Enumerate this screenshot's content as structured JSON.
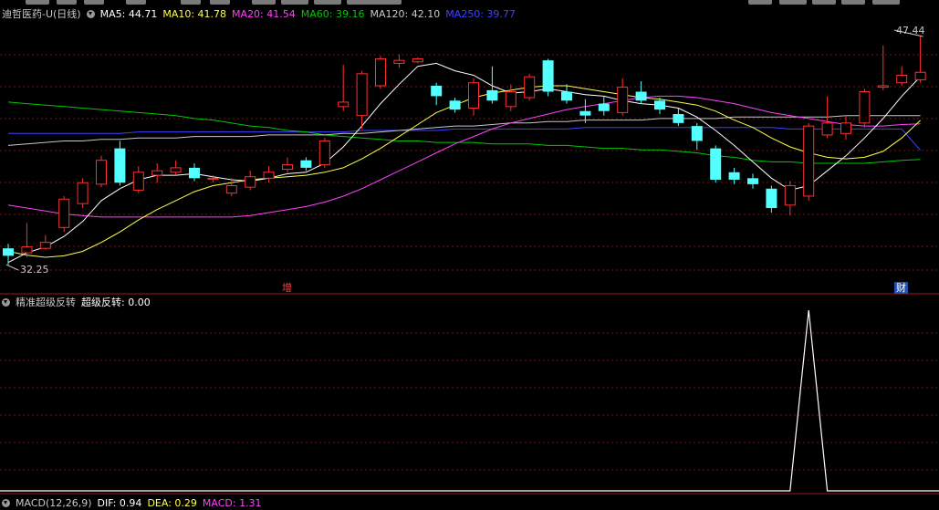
{
  "header": {
    "stock_name": "迪哲医药-U(日线)",
    "ma5": "MA5: 44.71",
    "ma10": "MA10: 41.78",
    "ma20": "MA20: 41.54",
    "ma60": "MA60: 39.16",
    "ma120": "MA120: 42.10",
    "ma250": "MA250: 39.77"
  },
  "colors": {
    "up": "#ff3030",
    "down": "#54ffff",
    "ma5": "#ffffff",
    "ma10": "#ffff4c",
    "ma20": "#ff40ff",
    "ma60": "#00c800",
    "ma120": "#c8c8c8",
    "ma250": "#4040ff",
    "grid": "#7a1010",
    "axis": "#a01818"
  },
  "markers": {
    "zeng": "增",
    "cai": "财"
  },
  "price_labels": {
    "high": "47.44",
    "low": "32.25"
  },
  "indicator": {
    "title": "精准超级反转",
    "value_text": "超级反转: 0.00"
  },
  "macd": {
    "label": "MACD(12,26,9)",
    "dif": "DIF: 0.94",
    "dea": "DEA: 0.29",
    "macd": "MACD: 1.31"
  },
  "chart_data": [
    {
      "type": "candlestick",
      "y_range": [
        31.5,
        48.5
      ],
      "candles": [
        [
          33.2,
          32.7,
          33.5,
          32.1
        ],
        [
          32.9,
          33.3,
          34.9,
          32.6
        ],
        [
          33.2,
          33.6,
          34.1,
          33.1
        ],
        [
          34.6,
          36.5,
          36.7,
          34.3
        ],
        [
          36.2,
          37.6,
          37.9,
          35.9
        ],
        [
          37.5,
          39.1,
          39.4,
          37.3
        ],
        [
          39.9,
          37.6,
          40.4,
          37.4
        ],
        [
          37.1,
          38.3,
          38.7,
          36.9
        ],
        [
          38.1,
          38.4,
          38.9,
          37.6
        ],
        [
          38.3,
          38.6,
          39.1,
          38.1
        ],
        [
          38.6,
          37.9,
          38.9,
          37.7
        ],
        [
          37.9,
          37.9,
          38.1,
          37.6
        ],
        [
          36.9,
          37.4,
          37.9,
          36.7
        ],
        [
          37.3,
          38.0,
          38.4,
          37.1
        ],
        [
          37.9,
          38.3,
          38.7,
          37.6
        ],
        [
          38.5,
          38.8,
          39.3,
          38.3
        ],
        [
          39.1,
          38.6,
          39.3,
          38.4
        ],
        [
          38.8,
          40.4,
          40.6,
          38.6
        ],
        [
          42.7,
          43.0,
          45.5,
          42.4
        ],
        [
          42.1,
          44.9,
          45.1,
          41.2
        ],
        [
          44.1,
          45.9,
          46.1,
          43.9
        ],
        [
          45.6,
          45.8,
          46.2,
          45.3
        ],
        [
          45.7,
          45.9,
          46.0,
          45.6
        ],
        [
          44.1,
          43.4,
          44.3,
          42.8
        ],
        [
          43.1,
          42.5,
          43.3,
          42.3
        ],
        [
          42.6,
          44.3,
          44.6,
          42.1
        ],
        [
          43.8,
          43.1,
          45.4,
          42.9
        ],
        [
          42.7,
          43.7,
          44.2,
          42.4
        ],
        [
          43.3,
          44.7,
          44.9,
          43.1
        ],
        [
          45.8,
          43.7,
          45.9,
          43.4
        ],
        [
          43.7,
          43.1,
          44.2,
          42.9
        ],
        [
          42.4,
          42.1,
          43.2,
          41.6
        ],
        [
          42.9,
          42.4,
          43.4,
          42.1
        ],
        [
          42.3,
          44.0,
          44.6,
          42.1
        ],
        [
          43.7,
          43.1,
          44.4,
          42.9
        ],
        [
          43.1,
          42.5,
          43.3,
          42.2
        ],
        [
          42.2,
          41.6,
          42.6,
          41.4
        ],
        [
          41.4,
          40.4,
          41.6,
          39.8
        ],
        [
          39.9,
          37.8,
          40.1,
          37.6
        ],
        [
          38.3,
          37.8,
          38.6,
          37.5
        ],
        [
          37.9,
          37.5,
          38.2,
          37.2
        ],
        [
          37.2,
          35.9,
          37.4,
          35.6
        ],
        [
          36.1,
          37.4,
          37.7,
          35.4
        ],
        [
          36.7,
          41.4,
          41.6,
          36.4
        ],
        [
          40.8,
          41.6,
          43.4,
          40.6
        ],
        [
          40.9,
          41.6,
          42.1,
          40.5
        ],
        [
          41.6,
          43.7,
          43.9,
          41.3
        ],
        [
          44.0,
          44.1,
          46.8,
          43.8
        ],
        [
          44.3,
          44.8,
          45.4,
          44.1
        ],
        [
          44.5,
          45.0,
          47.4,
          44.3
        ]
      ],
      "ma5": [
        32.25,
        32.9,
        33.3,
        34.0,
        35.0,
        36.4,
        37.2,
        37.8,
        38.1,
        38.1,
        38.2,
        38.0,
        37.8,
        37.7,
        37.9,
        38.2,
        38.3,
        38.9,
        40.0,
        41.4,
        42.9,
        44.2,
        45.4,
        45.6,
        45.1,
        44.8,
        44.1,
        43.6,
        43.7,
        43.9,
        43.7,
        43.5,
        43.4,
        43.1,
        42.9,
        42.8,
        42.6,
        42.0,
        41.1,
        40.1,
        39.0,
        37.9,
        37.1,
        37.4,
        38.4,
        39.4,
        40.6,
        41.9,
        43.4,
        44.71
      ],
      "ma10": [
        33.0,
        32.75,
        32.6,
        32.7,
        33.0,
        33.6,
        34.3,
        35.1,
        35.8,
        36.4,
        37.0,
        37.4,
        37.6,
        37.8,
        37.9,
        38.0,
        38.1,
        38.3,
        38.6,
        39.2,
        39.9,
        40.7,
        41.5,
        42.3,
        42.8,
        43.3,
        43.6,
        43.8,
        44.0,
        44.1,
        44.1,
        43.9,
        43.7,
        43.5,
        43.3,
        43.2,
        43.0,
        42.8,
        42.4,
        41.8,
        41.3,
        40.6,
        40.0,
        39.6,
        39.3,
        39.2,
        39.3,
        39.7,
        40.6,
        41.78
      ],
      "ma20": [
        36.1,
        35.9,
        35.7,
        35.5,
        35.4,
        35.3,
        35.3,
        35.3,
        35.3,
        35.3,
        35.3,
        35.3,
        35.3,
        35.4,
        35.6,
        35.8,
        36.0,
        36.3,
        36.7,
        37.2,
        37.8,
        38.4,
        39.0,
        39.6,
        40.2,
        40.7,
        41.2,
        41.6,
        41.9,
        42.2,
        42.5,
        42.7,
        42.9,
        43.1,
        43.3,
        43.4,
        43.4,
        43.3,
        43.1,
        42.9,
        42.6,
        42.3,
        42.1,
        41.9,
        41.7,
        41.5,
        41.4,
        41.4,
        41.5,
        41.54
      ],
      "ma60": [
        43.0,
        42.9,
        42.8,
        42.7,
        42.6,
        42.5,
        42.4,
        42.3,
        42.2,
        42.1,
        41.9,
        41.8,
        41.6,
        41.4,
        41.3,
        41.1,
        41.0,
        40.8,
        40.7,
        40.6,
        40.5,
        40.4,
        40.4,
        40.3,
        40.3,
        40.3,
        40.2,
        40.2,
        40.2,
        40.1,
        40.1,
        40.0,
        39.9,
        39.9,
        39.8,
        39.8,
        39.7,
        39.6,
        39.4,
        39.3,
        39.1,
        39.0,
        39.0,
        38.9,
        38.9,
        38.9,
        38.9,
        39.0,
        39.1,
        39.16
      ],
      "ma120": [
        40.1,
        40.2,
        40.3,
        40.4,
        40.4,
        40.5,
        40.5,
        40.6,
        40.6,
        40.6,
        40.7,
        40.7,
        40.7,
        40.7,
        40.8,
        40.8,
        40.8,
        40.8,
        40.9,
        40.9,
        41.0,
        41.1,
        41.2,
        41.3,
        41.4,
        41.4,
        41.5,
        41.6,
        41.6,
        41.7,
        41.7,
        41.8,
        41.8,
        41.8,
        41.8,
        41.9,
        41.9,
        41.9,
        41.9,
        42.0,
        42.0,
        42.0,
        42.0,
        42.0,
        42.0,
        42.1,
        42.1,
        42.1,
        42.1,
        42.1
      ],
      "ma250": [
        40.9,
        40.9,
        40.9,
        40.9,
        40.9,
        40.9,
        40.9,
        41.0,
        41.0,
        41.0,
        41.0,
        41.0,
        41.0,
        41.0,
        41.0,
        41.0,
        41.0,
        41.0,
        41.0,
        41.1,
        41.1,
        41.1,
        41.1,
        41.1,
        41.2,
        41.2,
        41.2,
        41.2,
        41.2,
        41.2,
        41.2,
        41.3,
        41.3,
        41.3,
        41.3,
        41.3,
        41.3,
        41.3,
        41.3,
        41.3,
        41.3,
        41.3,
        41.2,
        41.2,
        41.2,
        41.2,
        41.2,
        41.2,
        41.2,
        39.77
      ]
    },
    {
      "type": "line",
      "title": "精准超级反转",
      "y_range": [
        0,
        1
      ],
      "values": [
        0,
        0,
        0,
        0,
        0,
        0,
        0,
        0,
        0,
        0,
        0,
        0,
        0,
        0,
        0,
        0,
        0,
        0,
        0,
        0,
        0,
        0,
        0,
        0,
        0,
        0,
        0,
        0,
        0,
        0,
        0,
        0,
        0,
        0,
        0,
        0,
        0,
        0,
        0,
        0,
        0,
        0,
        0,
        1,
        0,
        0,
        0,
        0,
        0,
        0
      ]
    }
  ]
}
